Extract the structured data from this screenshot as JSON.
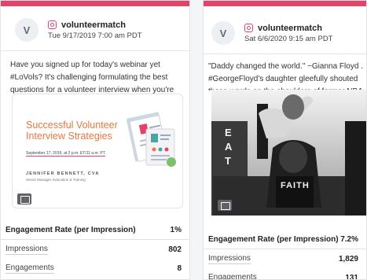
{
  "posts": [
    {
      "avatar_letter": "V",
      "account": "volunteermatch",
      "date": "Tue 9/17/2019 7:00 am PDT",
      "text": "Have you signed up for today's webinar yet #LoVols? It's challenging formulating the best questions for a volunteer interview when you're managing multiple...",
      "media": {
        "title": "Successful Volunteer Interview Strategies",
        "date_line": "September 17, 2019, at 2 p.m. ET/11 a.m. PT",
        "person": "JENNIFER BENNETT, CVA",
        "role": "Senior Manager, Education & Training",
        "badge_icon": "image-icon"
      },
      "metrics": {
        "header_label": "Engagement Rate (per Impression)",
        "header_value": "1%",
        "rows": [
          {
            "label": "Impressions",
            "value": "802"
          },
          {
            "label": "Engagements",
            "value": "8"
          }
        ]
      }
    },
    {
      "avatar_letter": "V",
      "account": "volunteermatch",
      "date": "Sat 6/6/2020 9:15 am PDT",
      "text": "\"Daddy changed the world.\" ~Gianna Floyd . #GeorgeFloyd's daughter gleefully shouted these words on the shoulders of former NBA star Stephen...",
      "media": {
        "shirt_text": "FAITH",
        "wall_text": "EAT",
        "badge_icon": "image-icon"
      },
      "metrics": {
        "header_label": "Engagement Rate (per Impression)",
        "header_value": "7.2%",
        "rows": [
          {
            "label": "Impressions",
            "value": "1,829"
          },
          {
            "label": "Engagements",
            "value": "131"
          }
        ]
      }
    }
  ],
  "colors": {
    "accent": "#e5426a",
    "promo_orange": "#e8783e"
  }
}
